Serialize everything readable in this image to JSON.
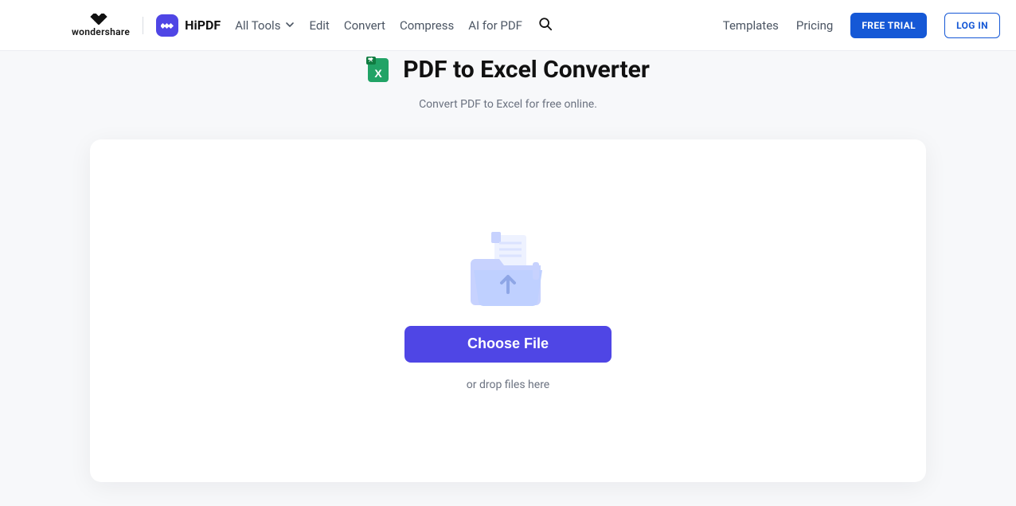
{
  "header": {
    "wondershare_word": "wondershare",
    "brand_name": "HiPDF",
    "menu": {
      "all_tools": "All Tools",
      "edit": "Edit",
      "convert": "Convert",
      "compress": "Compress",
      "ai_for_pdf": "AI for PDF"
    },
    "right": {
      "templates": "Templates",
      "pricing": "Pricing",
      "free_trial": "FREE TRIAL",
      "login": "LOG IN"
    }
  },
  "hero": {
    "title": "PDF to Excel Converter",
    "subtitle": "Convert PDF to Excel for free online."
  },
  "upload": {
    "choose_file": "Choose File",
    "drop_hint": "or drop files here"
  },
  "colors": {
    "accent_indigo": "#4F46E5",
    "accent_blue": "#1558d6",
    "excel_green": "#21a366",
    "page_bg": "#f7f8fa"
  }
}
